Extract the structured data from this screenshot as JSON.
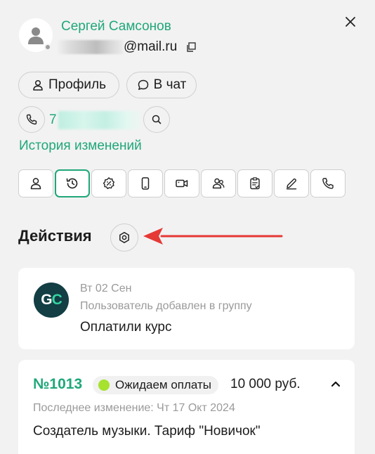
{
  "user": {
    "name": "Сергей Самсонов",
    "email_suffix": "@mail.ru",
    "phone_prefix": "7"
  },
  "actions": {
    "profile_label": "Профиль",
    "chat_label": "В чат"
  },
  "history_link": "История изменений",
  "tabs": [
    {
      "icon": "person-icon",
      "active": false
    },
    {
      "icon": "history-clock-icon",
      "active": true
    },
    {
      "icon": "discount-badge-icon",
      "active": false
    },
    {
      "icon": "mobile-phone-icon",
      "active": false
    },
    {
      "icon": "video-camera-icon",
      "active": false
    },
    {
      "icon": "users-icon",
      "active": false
    },
    {
      "icon": "clipboard-check-icon",
      "active": false
    },
    {
      "icon": "pencil-icon",
      "active": false
    },
    {
      "icon": "phone-icon",
      "active": false
    }
  ],
  "section": {
    "title": "Действия"
  },
  "event": {
    "logo_text_g": "G",
    "logo_text_c": "C",
    "date": "Вт 02 Сен",
    "description": "Пользователь добавлен в группу",
    "group": "Оплатили курс"
  },
  "order": {
    "number": "№1013",
    "status": "Ожидаем оплаты",
    "price": "10 000 руб.",
    "last_change": "Последнее изменение: Чт 17 Окт 2024",
    "title": "Создатель музыки. Тариф \"Новичок\""
  },
  "colors": {
    "accent": "#1fa77a",
    "status_dot": "#a6e22e",
    "arrow": "#e53935",
    "logo_bg": "#123e44"
  }
}
